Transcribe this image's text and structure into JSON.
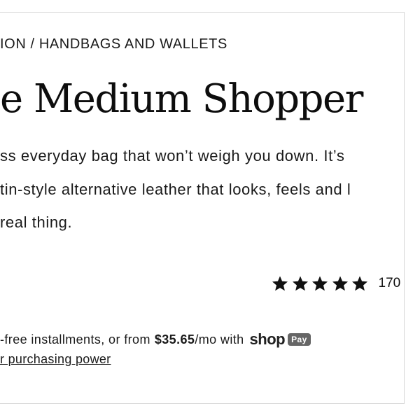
{
  "breadcrumb": "ION / HANDBAGS AND WALLETS",
  "product": {
    "title": "e Medium Shopper",
    "description_lines": [
      "ss everyday bag that won’t weigh you down. It’s",
      "tin-style alternative leather that looks, feels and l",
      "real thing."
    ]
  },
  "rating": {
    "stars": 5,
    "star_icon": "star-icon",
    "review_count": "170"
  },
  "installments": {
    "text_before": "-free installments, or from",
    "amount": "$35.65",
    "text_after": "/mo with",
    "shop_logo": "shop",
    "pay_badge": "Pay",
    "link": "r purchasing power"
  },
  "colors": {
    "text": "#111111",
    "border": "#d9d9d9",
    "pay_badge_bg": "#666666"
  }
}
